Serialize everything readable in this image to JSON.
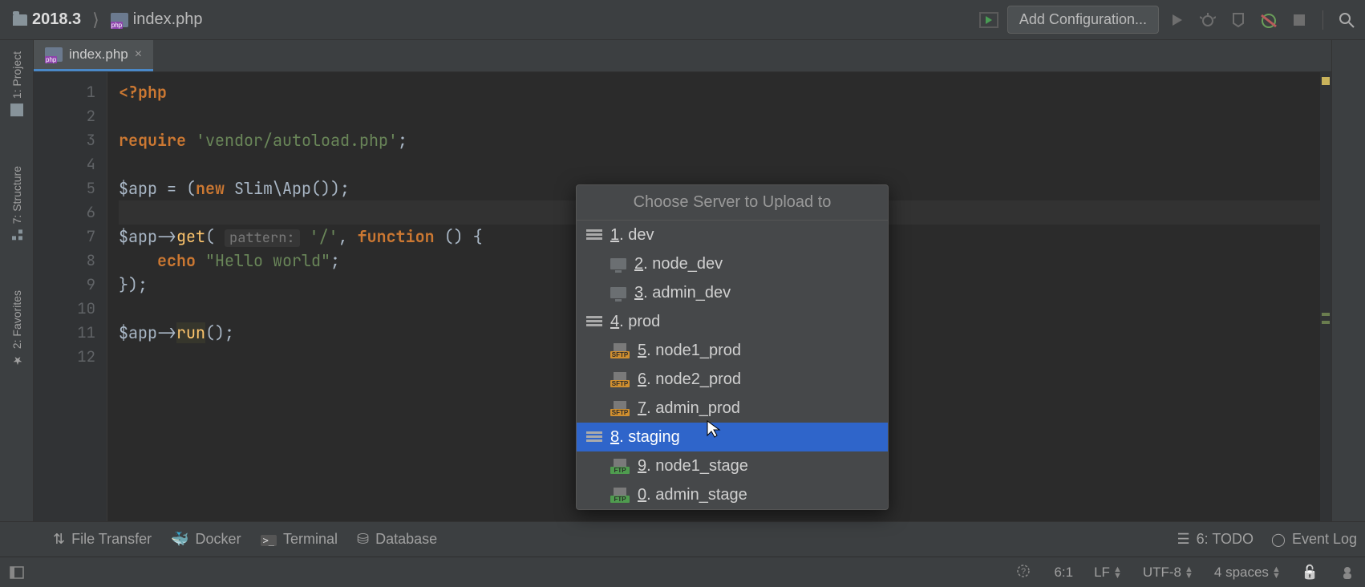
{
  "breadcrumb": {
    "root": "2018.3",
    "file": "index.php"
  },
  "toolbar": {
    "add_config": "Add Configuration..."
  },
  "tabs": [
    {
      "label": "index.php"
    }
  ],
  "gutter_lines": [
    "1",
    "2",
    "3",
    "4",
    "5",
    "6",
    "7",
    "8",
    "9",
    "10",
    "11",
    "12"
  ],
  "code": {
    "l1_open": "<?php",
    "l3_require": "require",
    "l3_str": "'vendor/autoload.php'",
    "l5_var": "$app",
    "l5_eq": " = (",
    "l5_new": "new",
    "l5_cls": " Slim\\App());",
    "l7_var": "$app",
    "l7_arrow": "->",
    "l7_get": "get",
    "l7_hint": "pattern:",
    "l7_str": "'/'",
    "l7_fn": "function",
    "l7_rest": " () {",
    "l8_echo": "echo",
    "l8_str": "\"Hello world\"",
    "l9": "});",
    "l11_var": "$app",
    "l11_arrow": "->",
    "l11_run": "run",
    "l11_rest": "();"
  },
  "popup": {
    "title": "Choose Server to Upload to",
    "items": [
      {
        "num": "1",
        "label": "dev",
        "icon": "server",
        "indent": 0
      },
      {
        "num": "2",
        "label": "node_dev",
        "icon": "host",
        "indent": 1
      },
      {
        "num": "3",
        "label": "admin_dev",
        "icon": "host",
        "indent": 1
      },
      {
        "num": "4",
        "label": "prod",
        "icon": "server",
        "indent": 0
      },
      {
        "num": "5",
        "label": "node1_prod",
        "icon": "sftp",
        "indent": 1
      },
      {
        "num": "6",
        "label": "node2_prod",
        "icon": "sftp",
        "indent": 1
      },
      {
        "num": "7",
        "label": "admin_prod",
        "icon": "sftp",
        "indent": 1
      },
      {
        "num": "8",
        "label": "staging",
        "icon": "server",
        "indent": 0,
        "selected": true
      },
      {
        "num": "9",
        "label": "node1_stage",
        "icon": "ftp",
        "indent": 1
      },
      {
        "num": "0",
        "label": "admin_stage",
        "icon": "ftp",
        "indent": 1
      }
    ]
  },
  "left_rail": {
    "project": "1: Project",
    "structure": "7: Structure",
    "favorites": "2: Favorites"
  },
  "bottom": {
    "file_transfer": "File Transfer",
    "docker": "Docker",
    "terminal": "Terminal",
    "database": "Database",
    "todo": "6: TODO",
    "event_log": "Event Log"
  },
  "status": {
    "caret": "6:1",
    "line_sep": "LF",
    "encoding": "UTF-8",
    "indent": "4 spaces"
  }
}
